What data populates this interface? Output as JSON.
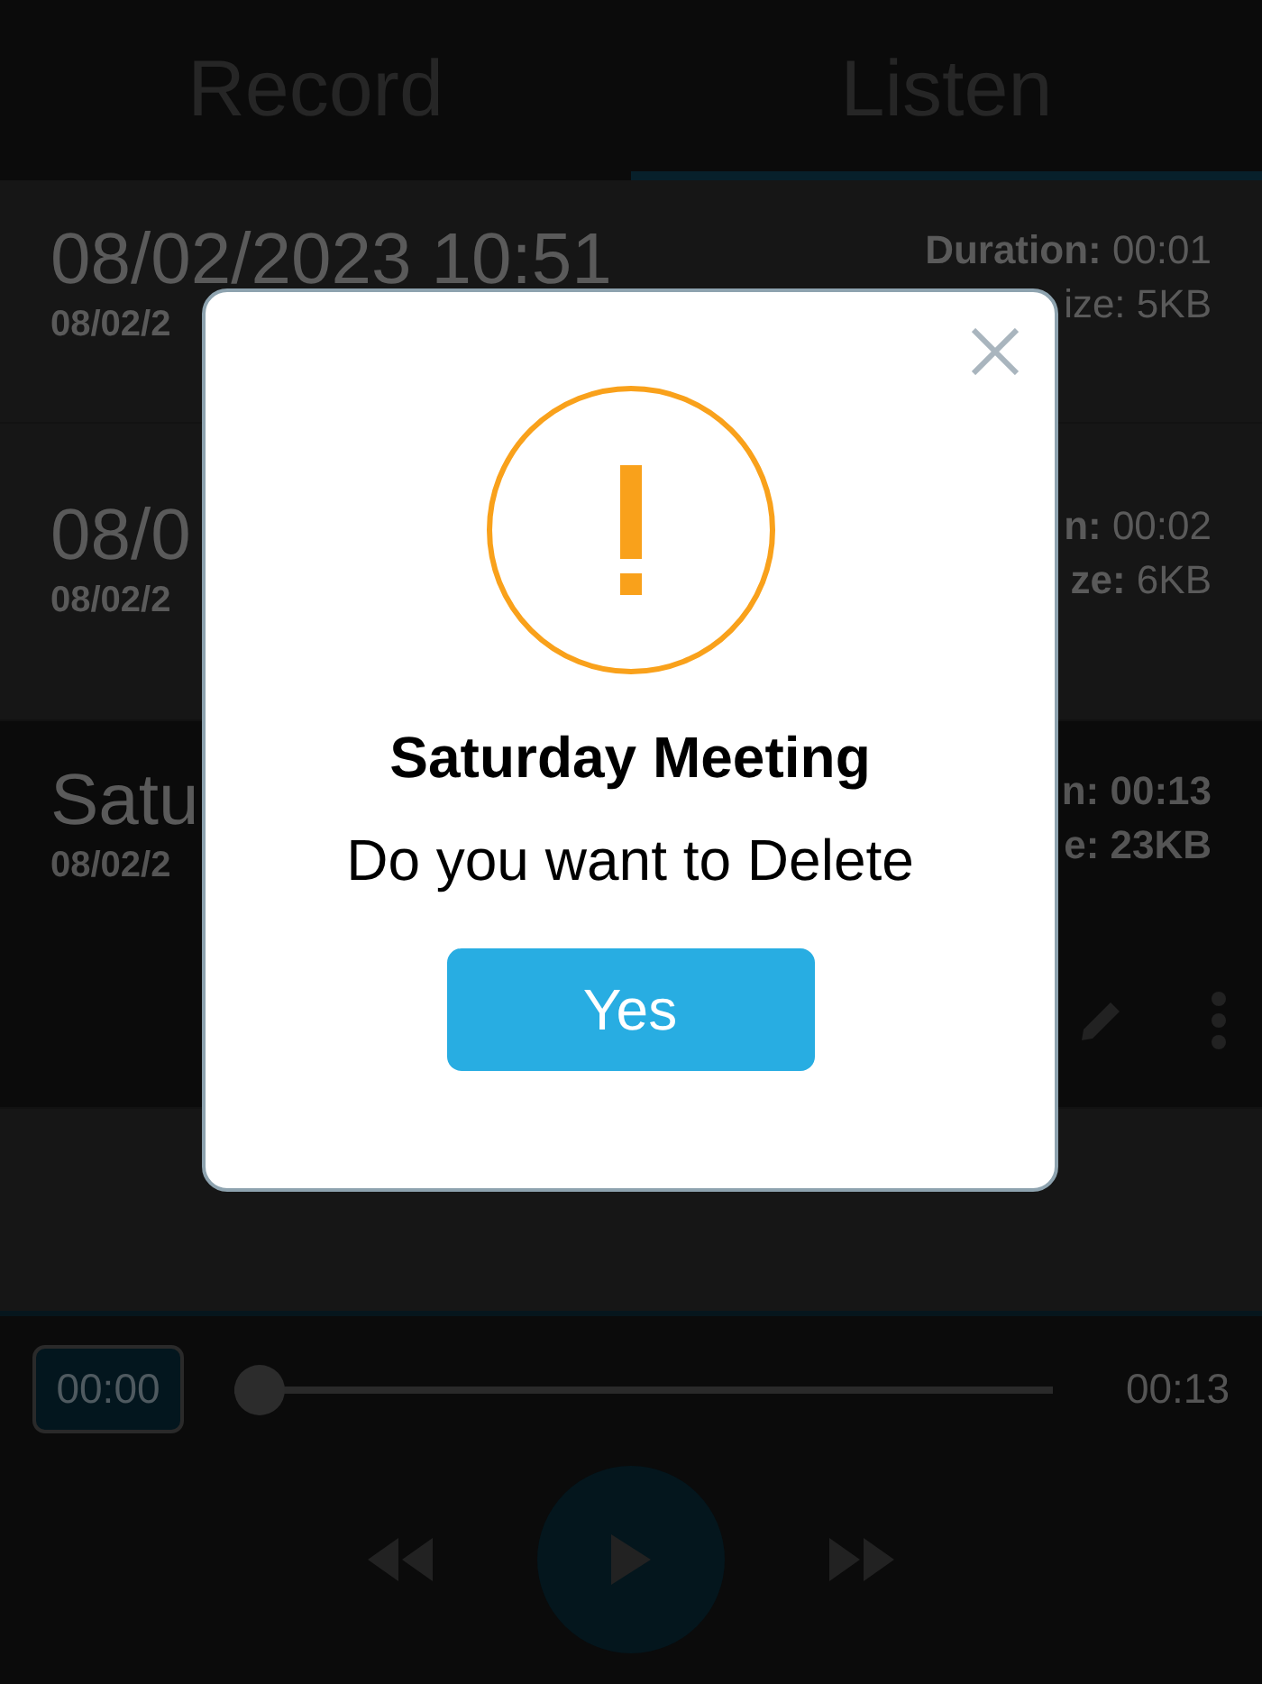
{
  "tabs": [
    {
      "label": "Record",
      "selected": false
    },
    {
      "label": "Listen",
      "selected": true
    }
  ],
  "recordings": [
    {
      "title": "08/02/2023 10:51",
      "date": "08/02/2",
      "duration": "**Duration:** 00:01",
      "size": "ize: 5KB",
      "expanded": false
    },
    {
      "title": "08/0",
      "date": "08/02/2",
      "duration": "**n:** 00:02",
      "size": "**ze:** 6KB",
      "expanded": false
    },
    {
      "title": "Satu",
      "date": "08/02/2",
      "duration": "n: 00:13",
      "size": "e: 23KB",
      "expanded": true
    }
  ],
  "player": {
    "current_time": "00:00",
    "total_time": "00:13",
    "level": 0
  },
  "dialog": {
    "title": "Saturday Meeting",
    "message": "Do you want to Delete",
    "confirm_button": "Yes"
  }
}
